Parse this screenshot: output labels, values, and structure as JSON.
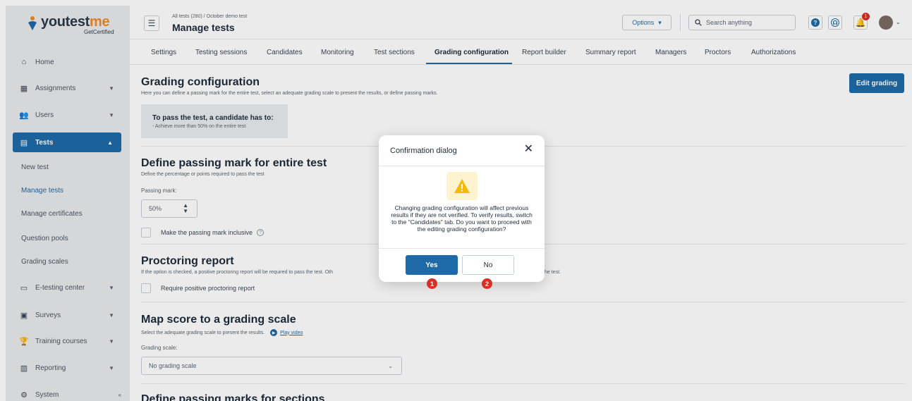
{
  "brand": {
    "name_part1": "youtest",
    "name_part2": "me",
    "sub": "GetCertified"
  },
  "sidebar": {
    "home": "Home",
    "assignments": "Assignments",
    "users": "Users",
    "tests": "Tests",
    "sub_items": [
      "New test",
      "Manage tests",
      "Manage certificates",
      "Question pools",
      "Grading scales"
    ],
    "etesting": "E-testing center",
    "surveys": "Surveys",
    "training": "Training courses",
    "reporting": "Reporting",
    "system": "System"
  },
  "header": {
    "breadcrumb": "All tests (280)  /  October demo test",
    "title": "Manage tests",
    "options_label": "Options",
    "search_placeholder": "Search anything",
    "notification_count": "1"
  },
  "tabs": [
    "Settings",
    "Testing sessions",
    "Candidates",
    "Monitoring",
    "Test sections",
    "Grading configuration",
    "Report builder",
    "Summary report",
    "Managers",
    "Proctors",
    "Authorizations"
  ],
  "grading": {
    "title": "Grading configuration",
    "desc": "Here you can define a passing mark for the entire test, select an adequate grading scale to present the results, or define passing marks.",
    "edit_label": "Edit grading",
    "pass_title": "To pass the test, a candidate has to:",
    "pass_sub": "- Achieve more than 50% on the entire test"
  },
  "passing": {
    "title": "Define passing mark for entire test",
    "desc": "Define the percentage or points required to pass the test",
    "label": "Passing mark:",
    "value": "50%",
    "inclusive_label": "Make the passing mark inclusive"
  },
  "proctoring": {
    "title": "Proctoring report",
    "desc_left": "If the option is checked, a positive proctoring report will be required to pass the test. Oth",
    "desc_right": "he test.",
    "checkbox_label": "Require positive proctoring report"
  },
  "map": {
    "title": "Map score to a grading scale",
    "desc": "Select the adequate grading scale to present the results.",
    "video_link": "Play video",
    "label": "Grading scale:",
    "value": "No grading scale"
  },
  "sections": {
    "title": "Define passing marks for sections"
  },
  "dialog": {
    "title": "Confirmation dialog",
    "message": "Changing grading configuration will affect previous results if they are not verified. To verify results, switch to the \"Candidates\" tab. Do you want to proceed with the editing grading configuration?",
    "yes_label": "Yes",
    "no_label": "No",
    "marker_1": "1",
    "marker_2": "2"
  }
}
